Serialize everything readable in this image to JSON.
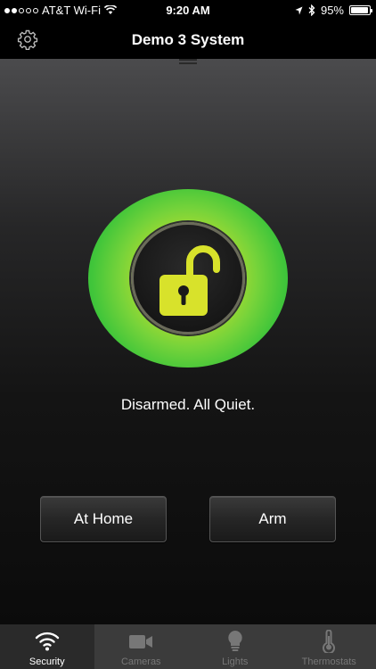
{
  "status_bar": {
    "carrier": "AT&T Wi-Fi",
    "time": "9:20 AM",
    "battery": "95%",
    "battery_level": 0.95,
    "signal_bars": 2
  },
  "nav": {
    "title": "Demo 3 System",
    "settings_icon": "gear-icon"
  },
  "security": {
    "status_text": "Disarmed. All Quiet.",
    "lock_state": "unlocked",
    "halo_color": "#4cc83a",
    "lock_color": "#d8e22b"
  },
  "buttons": {
    "at_home": "At Home",
    "arm": "Arm"
  },
  "tabs": [
    {
      "label": "Security",
      "icon": "wifi-signal-icon",
      "active": true
    },
    {
      "label": "Cameras",
      "icon": "video-camera-icon",
      "active": false
    },
    {
      "label": "Lights",
      "icon": "light-bulb-icon",
      "active": false
    },
    {
      "label": "Thermostats",
      "icon": "thermometer-icon",
      "active": false
    }
  ]
}
